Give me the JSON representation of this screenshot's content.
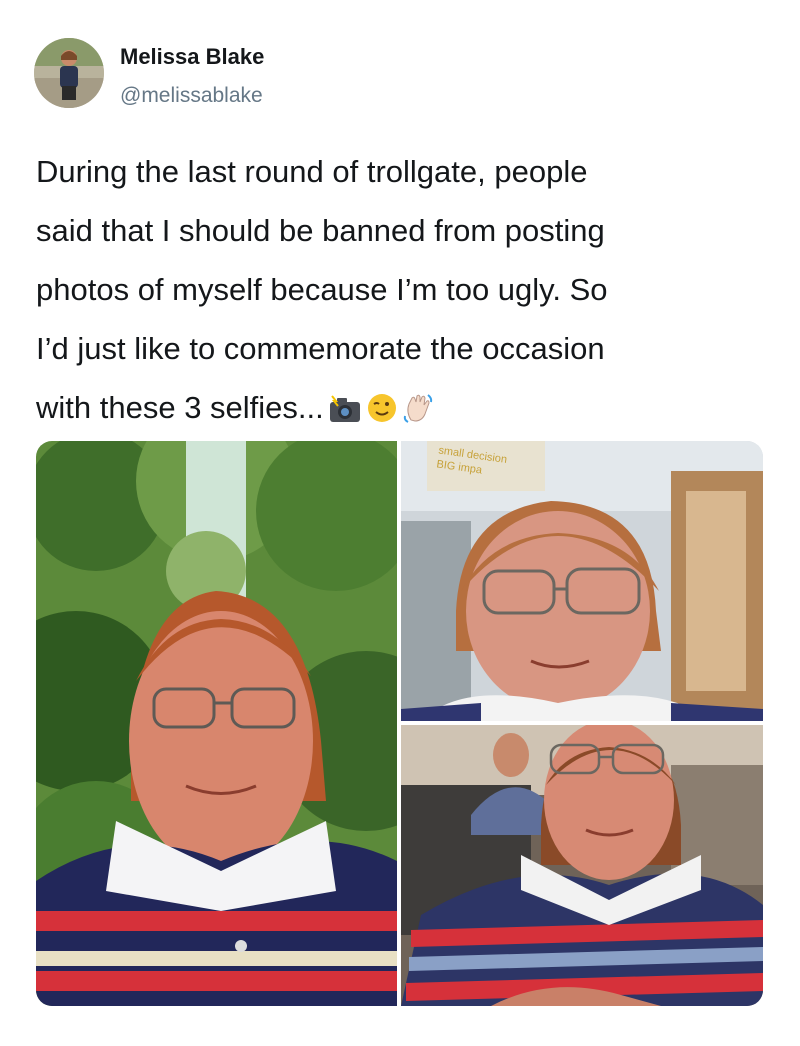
{
  "user": {
    "display_name": "Melissa Blake",
    "handle": "@melissablake"
  },
  "tweet": {
    "lines": [
      "During the last round of trollgate, people",
      "said that I should be banned from posting",
      "photos of myself because I’m too ugly. So",
      "I’d just like to commemorate the occasion",
      "with these 3 selfies..."
    ],
    "emojis": [
      "camera-with-flash-icon",
      "winking-face-icon",
      "waving-hand-icon"
    ]
  },
  "media": {
    "photo_2_sign_line_1": "small decision",
    "photo_2_sign_line_2": "BIG impa"
  },
  "colors": {
    "text": "#14171a",
    "secondary": "#657786"
  }
}
